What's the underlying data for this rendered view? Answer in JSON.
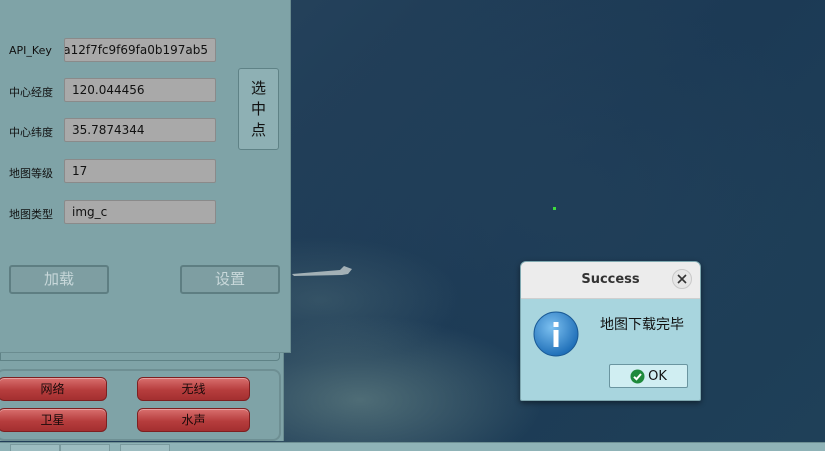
{
  "form": {
    "api_key": {
      "label": "API_Key",
      "value": "a12f7fc9f69fa0b197ab5"
    },
    "center_lon": {
      "label": "中心经度",
      "value": "120.044456"
    },
    "center_lat": {
      "label": "中心纬度",
      "value": "35.7874344"
    },
    "zoom_level": {
      "label": "地图等级",
      "value": "17"
    },
    "map_type": {
      "label": "地图类型",
      "value": "img_c"
    },
    "pick_point_chars": [
      "选",
      "中",
      "点"
    ],
    "load_label": "加载",
    "settings_label": "设置"
  },
  "mode_buttons": {
    "network": "网络",
    "wireless": "无线",
    "satellite": "卫星",
    "acoustic": "水声"
  },
  "dialog": {
    "title": "Success",
    "message": "地图下载完毕",
    "ok_label": "OK",
    "info_icon": "info-icon",
    "ok_icon": "check-circle-icon"
  },
  "colors": {
    "panel": "#7fa3a7",
    "dialog": "#a8d5de",
    "mode_button": "#b63d3d",
    "map_water": "#213e58"
  }
}
